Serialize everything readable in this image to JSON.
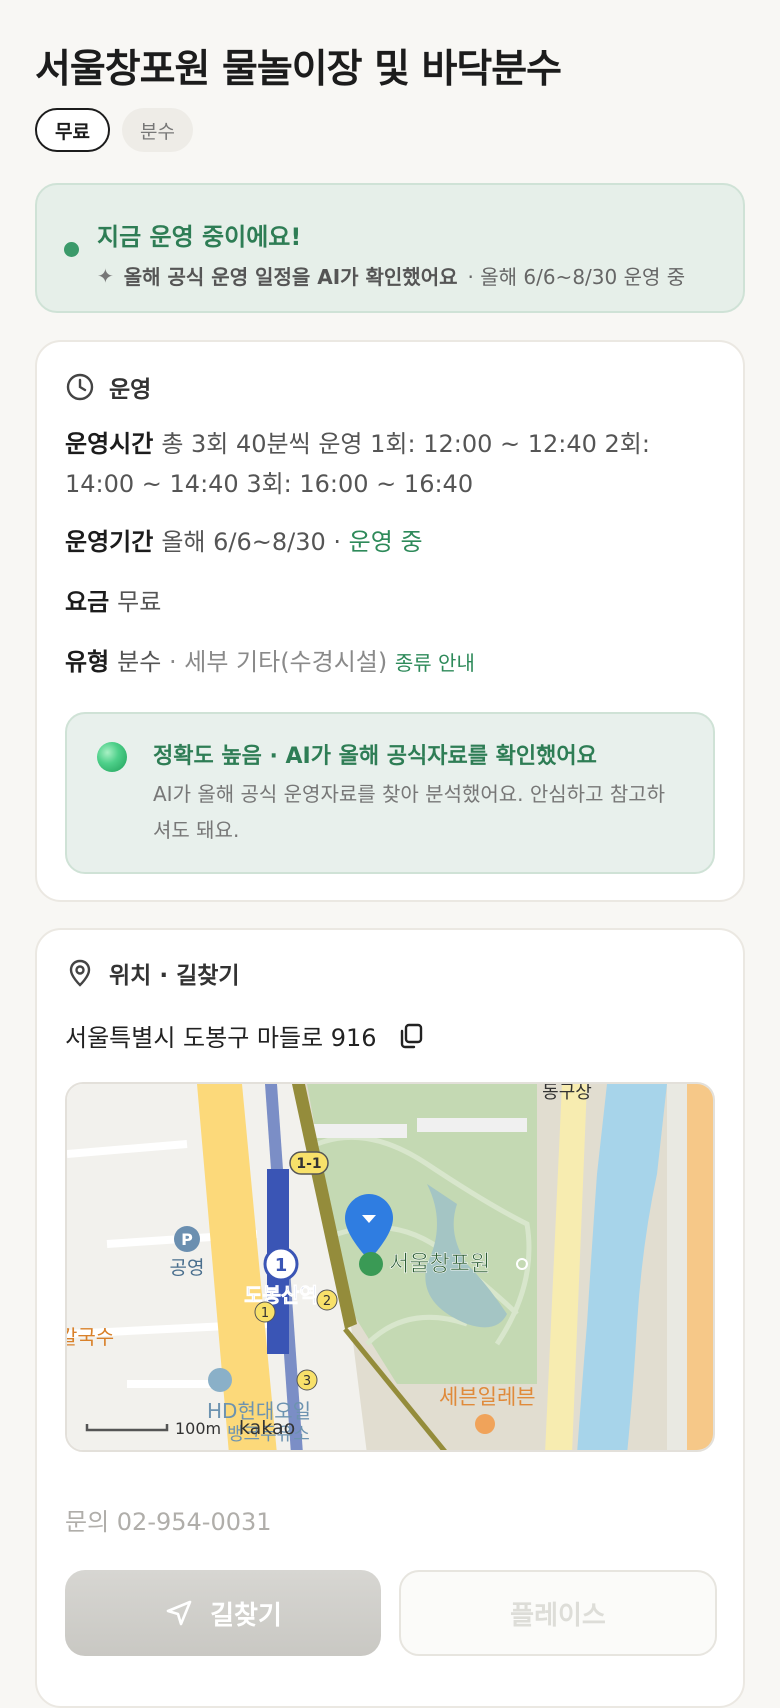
{
  "header": {
    "title": "서울창포원 물놀이장 및 바닥분수",
    "chips": [
      "무료",
      "분수"
    ]
  },
  "status": {
    "headline": "지금 운영 중이에요!",
    "ai_note": "올해 공식 운영 일정을 AI가 확인했어요",
    "period_note": "· 올해 6/6~8/30 운영 중",
    "accent": "#2e7d55"
  },
  "operation": {
    "section_title": "운영",
    "hours_key": "운영시간",
    "hours_value": "총 3회 40분씩 운영 1회: 12:00 ~ 12:40 2회: 14:00 ~ 14:40 3회: 16:00 ~ 16:40",
    "period_key": "운영기간",
    "period_value": "올해 6/6~8/30",
    "period_sep": "·",
    "period_status": "운영 중",
    "fee_key": "요금",
    "fee_value": "무료",
    "type_key": "유형",
    "type_value": "분수",
    "type_detail": "· 세부 기타(수경시설)",
    "type_link": "종류 안내",
    "accuracy_title": "정확도 높음 · AI가 올해 공식자료를 확인했어요",
    "accuracy_desc": "AI가 올해 공식 운영자료를 찾아 분석했어요. 안심하고 참고하셔도 돼요."
  },
  "location": {
    "section_title": "위치 · 길찾기",
    "address": "서울특별시 도봉구 마들로 916",
    "map": {
      "labels": {
        "top": "동구상",
        "line1": "1-1",
        "station_no": "1",
        "station": "도봉산역",
        "park": "서울창포원",
        "parking": "공영",
        "parking_icon": "P",
        "left": "칼국수",
        "hd": "HD현대오일",
        "hd2": "뱅크두유소",
        "seven": "세븐일레븐",
        "scale": "100m",
        "brand": "kakao",
        "exit1": "1",
        "exit2": "2",
        "exit3": "3"
      }
    },
    "inquiry": "문의 02-954-0031"
  },
  "actions": {
    "route": "길찾기",
    "place": "플레이스"
  }
}
